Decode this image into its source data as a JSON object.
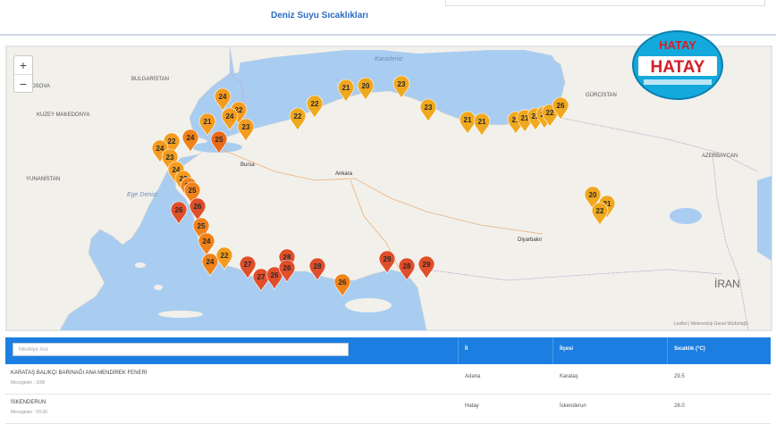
{
  "header": {
    "title": "Deniz Suyu Sıcaklıkları"
  },
  "map": {
    "zoom_in": "+",
    "zoom_out": "−",
    "attribution": "Leaflet | Meteoroloji Genel Müdürlüğü",
    "labels": {
      "sea_black": "Karadeniz",
      "sea_aegean": "Ege Denizi",
      "bulgaria": "BULGARİSTAN",
      "kosovo": "KOSOVA",
      "macedonia": "KUZEY MAKEDONYA",
      "greece": "YUNANİSTAN",
      "georgia": "GÜRCİSTAN",
      "azerbaijan": "AZERBAYCAN",
      "iran": "İRAN",
      "ankara": "Ankara",
      "diyarbakir": "Diyarbakır",
      "bursa": "Bursa"
    },
    "markers": [
      {
        "value": "24",
        "color": "#f39c1e"
      },
      {
        "value": "22",
        "color": "#f39c1e"
      },
      {
        "value": "24",
        "color": "#f39c1e"
      },
      {
        "value": "21",
        "color": "#f39c1e"
      },
      {
        "value": "23",
        "color": "#f39c1e"
      },
      {
        "value": "24",
        "color": "#f0821a"
      },
      {
        "value": "25",
        "color": "#ea6a18"
      },
      {
        "value": "22",
        "color": "#f39c1e"
      },
      {
        "value": "24",
        "color": "#f39c1e"
      },
      {
        "value": "23",
        "color": "#f39c1e"
      },
      {
        "value": "21",
        "color": "#f0a81e"
      },
      {
        "value": "20",
        "color": "#f0a81e"
      },
      {
        "value": "23",
        "color": "#f0a81e"
      },
      {
        "value": "22",
        "color": "#f0a81e"
      },
      {
        "value": "22",
        "color": "#f0a81e"
      },
      {
        "value": "23",
        "color": "#f0a81e"
      },
      {
        "value": "21",
        "color": "#f0a81e"
      },
      {
        "value": "21",
        "color": "#f0a81e"
      },
      {
        "value": "21",
        "color": "#f0a81e"
      },
      {
        "value": "21",
        "color": "#f0a81e"
      },
      {
        "value": "23",
        "color": "#f0a81e"
      },
      {
        "value": "22",
        "color": "#f0a81e"
      },
      {
        "value": "22",
        "color": "#f0a81e"
      },
      {
        "value": "26",
        "color": "#f0a81e"
      },
      {
        "value": "24",
        "color": "#f39c1e"
      },
      {
        "value": "22",
        "color": "#f39c1e"
      },
      {
        "value": "25",
        "color": "#f0821a"
      },
      {
        "value": "25",
        "color": "#f0821a"
      },
      {
        "value": "26",
        "color": "#e04e2a"
      },
      {
        "value": "26",
        "color": "#e04e2a"
      },
      {
        "value": "25",
        "color": "#f0821a"
      },
      {
        "value": "24",
        "color": "#f0821a"
      },
      {
        "value": "24",
        "color": "#f0821a"
      },
      {
        "value": "22",
        "color": "#f39c1e"
      },
      {
        "value": "27",
        "color": "#e04e2a"
      },
      {
        "value": "27",
        "color": "#e04e2a"
      },
      {
        "value": "26",
        "color": "#e04e2a"
      },
      {
        "value": "28",
        "color": "#e04e2a"
      },
      {
        "value": "26",
        "color": "#e04e2a"
      },
      {
        "value": "28",
        "color": "#e04e2a"
      },
      {
        "value": "26",
        "color": "#f0821a"
      },
      {
        "value": "29",
        "color": "#e04e2a"
      },
      {
        "value": "28",
        "color": "#e04e2a"
      },
      {
        "value": "29",
        "color": "#e04e2a"
      },
      {
        "value": "20",
        "color": "#f0a81e"
      },
      {
        "value": "21",
        "color": "#f0a81e"
      },
      {
        "value": "22",
        "color": "#f0a81e"
      }
    ]
  },
  "logo": {
    "text_top": "HATAY",
    "text_main": "HATAY"
  },
  "table": {
    "search_placeholder": "Mevkiye Ara",
    "columns": [
      "İl",
      "İlçesi",
      "Sıcaklık (°C)"
    ],
    "rows": [
      {
        "name": "KARATAŞ BALIKÇI BARINAĞI ANA MENDİREK FENERİ",
        "sub": "Mevzgenin : 10/8",
        "il": "Adana",
        "ilce": "Karataş",
        "temp": "29.5"
      },
      {
        "name": "İSKENDERUN",
        "sub": "Mevzgenin : 09:30",
        "il": "Hatay",
        "ilce": "İskenderun",
        "temp": "28.0"
      }
    ]
  },
  "colors": {
    "sea": "#a9cdf0",
    "land": "#f2f0eb",
    "header_blue": "#1b7ee0"
  }
}
